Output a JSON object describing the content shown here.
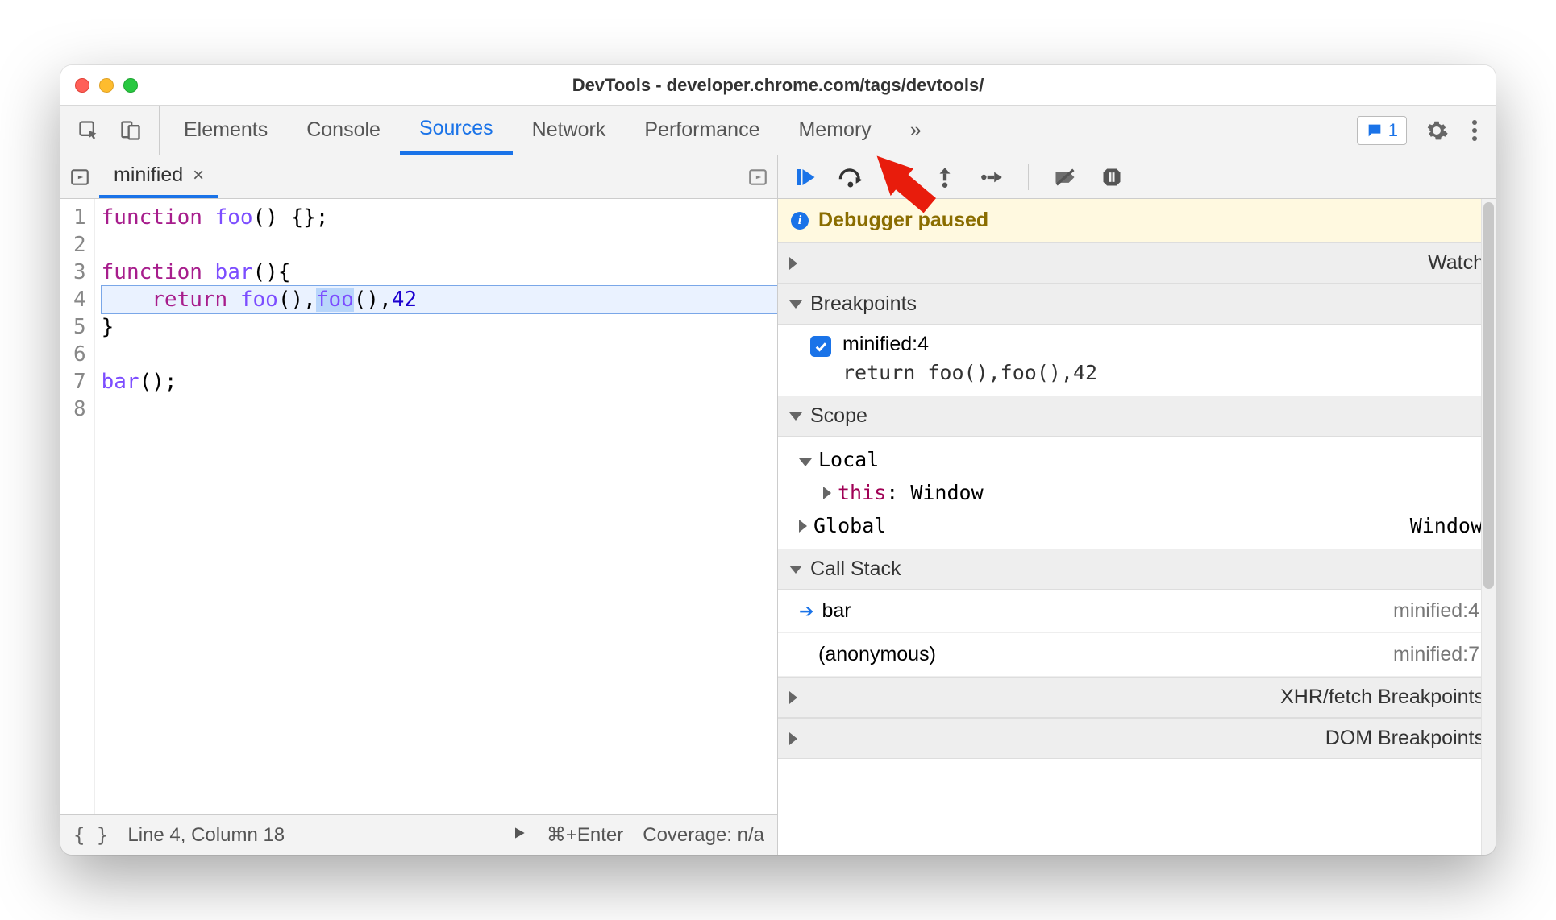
{
  "window": {
    "title": "DevTools - developer.chrome.com/tags/devtools/"
  },
  "tabs": {
    "items": [
      "Elements",
      "Console",
      "Sources",
      "Network",
      "Performance",
      "Memory"
    ],
    "active_index": 2,
    "overflow_glyph": "»",
    "message_count": "1"
  },
  "file_tab": {
    "name": "minified",
    "close": "×"
  },
  "code": {
    "lines": [
      {
        "n": "1",
        "html": "<span class='kw'>function</span> <span class='fn'>foo</span>() {};"
      },
      {
        "n": "2",
        "html": ""
      },
      {
        "n": "3",
        "html": "<span class='kw'>function</span> <span class='fn'>bar</span>(){"
      },
      {
        "n": "4",
        "html": "    <span class='ret'>return</span> <span class='fn'>foo</span>(),<span class='sel'><span class='fn'>foo</span></span>(),<span class='num'>42</span>",
        "highlight": true
      },
      {
        "n": "5",
        "html": "}"
      },
      {
        "n": "6",
        "html": ""
      },
      {
        "n": "7",
        "html": "<span class='fn'>bar</span>();"
      },
      {
        "n": "8",
        "html": ""
      }
    ]
  },
  "statusbar": {
    "braces": "{ }",
    "pos": "Line 4, Column 18",
    "run_hint": "⌘+Enter",
    "coverage": "Coverage: n/a"
  },
  "debugger": {
    "banner": "Debugger paused",
    "sections": {
      "watch": "Watch",
      "breakpoints": "Breakpoints",
      "scope": "Scope",
      "callstack": "Call Stack",
      "xhr": "XHR/fetch Breakpoints",
      "dom": "DOM Breakpoints"
    },
    "breakpoints": [
      {
        "checked": true,
        "label": "minified:4",
        "preview": "return foo(),foo(),42"
      }
    ],
    "scope": {
      "local": {
        "label": "Local",
        "this_key": "this",
        "this_val": "Window"
      },
      "global": {
        "label": "Global",
        "val": "Window"
      }
    },
    "callstack": [
      {
        "active": true,
        "fn": "bar",
        "loc": "minified:4"
      },
      {
        "active": false,
        "fn": "(anonymous)",
        "loc": "minified:7"
      }
    ]
  },
  "icons": {
    "inspect": "inspect-icon",
    "device": "device-icon",
    "nav_toggle": "navigator-toggle-icon",
    "run_snippet": "run-snippet-icon",
    "resume": "resume-icon",
    "step_over": "step-over-icon",
    "step_into": "step-into-icon",
    "step_out": "step-out-icon",
    "step": "step-icon",
    "deactivate_bp": "deactivate-breakpoints-icon",
    "pause_exc": "pause-on-exceptions-icon",
    "gear": "gear-icon",
    "message": "message-icon",
    "more": "more-icon",
    "play_triangle": "play-icon"
  }
}
